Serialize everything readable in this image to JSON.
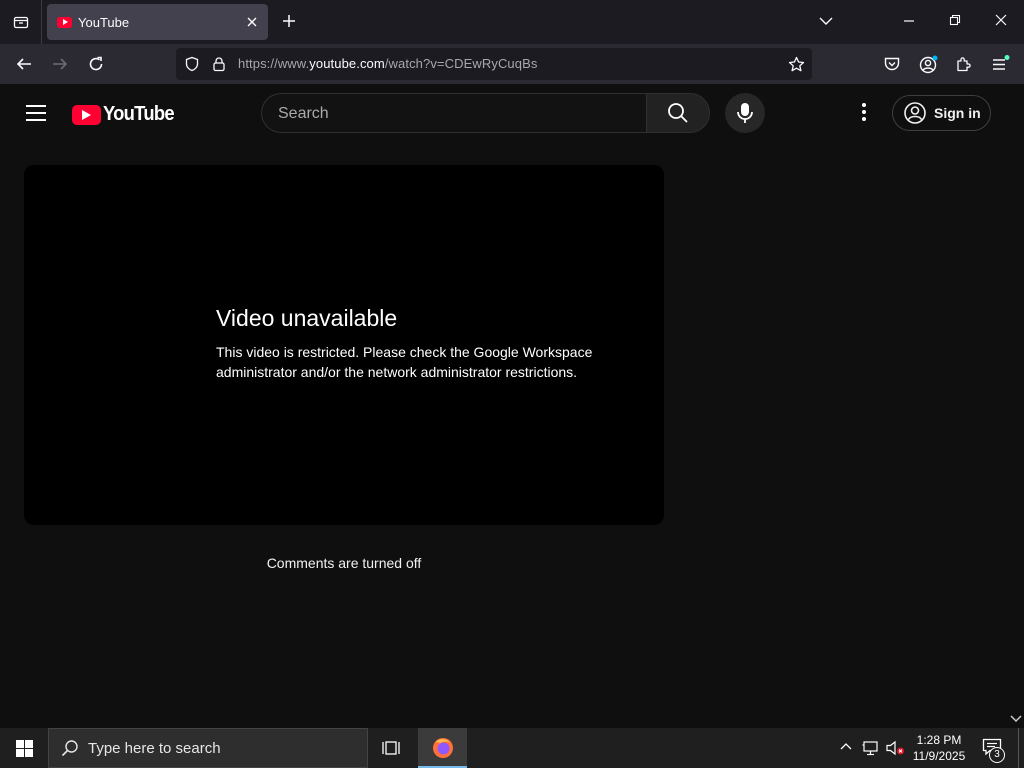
{
  "browser": {
    "tab": {
      "title": "YouTube"
    },
    "url": {
      "prefix": "https://www.",
      "domain": "youtube.com",
      "path": "/watch?v=CDEwRyCuqBs"
    }
  },
  "youtube": {
    "logo_text": "YouTube",
    "search_placeholder": "Search",
    "sign_in_label": "Sign in",
    "brand_color": "#ff0033"
  },
  "player": {
    "error_title": "Video unavailable",
    "error_message": "This video is restricted. Please check the Google Workspace administrator and/or the network administrator restrictions."
  },
  "comments_text": "Comments are turned off",
  "taskbar": {
    "search_placeholder": "Type here to search",
    "time": "1:28 PM",
    "date": "11/9/2025",
    "notification_count": "3"
  }
}
